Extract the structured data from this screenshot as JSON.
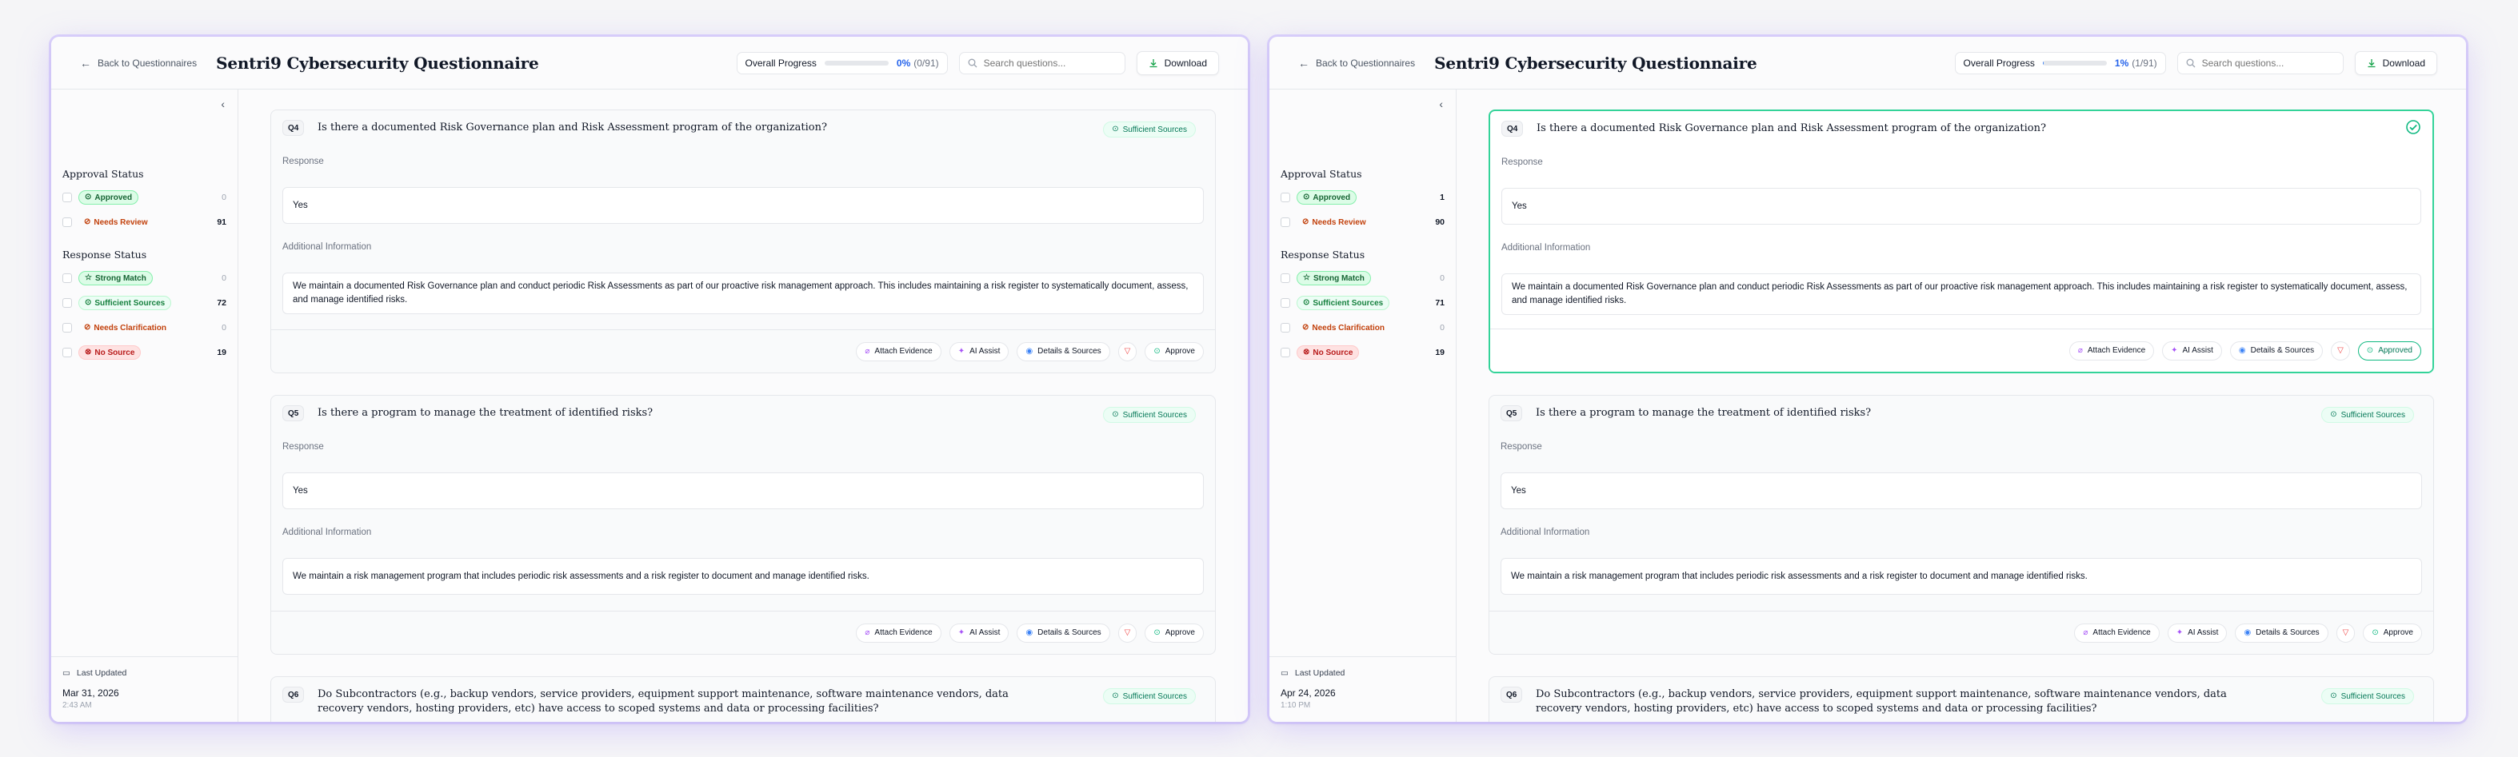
{
  "colors": {
    "accent": "#2563eb",
    "approved": "#10b981",
    "needs_review": "#c2410c",
    "no_source": "#b91c1c"
  },
  "panels": [
    {
      "header": {
        "back_label": "Back to Questionnaires",
        "title": "Sentri9 Cybersecurity Questionnaire",
        "progress_label": "Overall Progress",
        "progress_pct": "0%",
        "progress_count": "(0/91)",
        "progress_fraction": 0.0,
        "search_placeholder": "Search questions...",
        "download_label": "Download"
      },
      "sidebar": {
        "approval_heading": "Approval Status",
        "approved_label": "Approved",
        "approved_count": "0",
        "needs_review_label": "Needs Review",
        "needs_review_count": "91",
        "response_heading": "Response Status",
        "strong_label": "Strong Match",
        "strong_count": "0",
        "sufficient_label": "Sufficient Sources",
        "sufficient_count": "72",
        "clarify_label": "Needs Clarification",
        "clarify_count": "0",
        "nosource_label": "No Source",
        "nosource_count": "19",
        "last_updated_label": "Last Updated",
        "date": "Mar 31, 2026",
        "time": "2:43 AM"
      },
      "questions": [
        {
          "no": "Q4",
          "text": "Is there a documented Risk Governance plan and Risk Assessment program of the organization?",
          "source": "Sufficient Sources",
          "response_label": "Response",
          "response": "Yes",
          "additional_label": "Additional Information",
          "additional": "We maintain a documented Risk Governance plan and conduct periodic Risk Assessments as part of our proactive risk management approach. This includes maintaining a risk register to systematically document, assess, and manage identified risks.",
          "attach": "Attach Evidence",
          "assist": "AI Assist",
          "details": "Details & Sources",
          "approve": "Approve"
        },
        {
          "no": "Q5",
          "text": "Is there a program to manage the treatment of identified risks?",
          "source": "Sufficient Sources",
          "response_label": "Response",
          "response": "Yes",
          "additional_label": "Additional Information",
          "additional": "We maintain a risk management program that includes periodic risk assessments and a risk register to document and manage identified risks.",
          "attach": "Attach Evidence",
          "assist": "AI Assist",
          "details": "Details & Sources",
          "approve": "Approve"
        },
        {
          "no": "Q6",
          "text": "Do Subcontractors (e.g., backup vendors, service providers, equipment support maintenance, software maintenance vendors, data recovery vendors, hosting providers, etc) have access to scoped systems and data or processing facilities?",
          "source": "Sufficient Sources"
        }
      ]
    },
    {
      "header": {
        "back_label": "Back to Questionnaires",
        "title": "Sentri9 Cybersecurity Questionnaire",
        "progress_label": "Overall Progress",
        "progress_pct": "1%",
        "progress_count": "(1/91)",
        "progress_fraction": 0.01,
        "search_placeholder": "Search questions...",
        "download_label": "Download"
      },
      "sidebar": {
        "approval_heading": "Approval Status",
        "approved_label": "Approved",
        "approved_count": "1",
        "needs_review_label": "Needs Review",
        "needs_review_count": "90",
        "response_heading": "Response Status",
        "strong_label": "Strong Match",
        "strong_count": "0",
        "sufficient_label": "Sufficient Sources",
        "sufficient_count": "71",
        "clarify_label": "Needs Clarification",
        "clarify_count": "0",
        "nosource_label": "No Source",
        "nosource_count": "19",
        "last_updated_label": "Last Updated",
        "date": "Apr 24, 2026",
        "time": "1:10 PM"
      },
      "questions": [
        {
          "no": "Q4",
          "text": "Is there a documented Risk Governance plan and Risk Assessment program of the organization?",
          "response_label": "Response",
          "response": "Yes",
          "additional_label": "Additional Information",
          "additional": "We maintain a documented Risk Governance plan and conduct periodic Risk Assessments as part of our proactive risk management approach. This includes maintaining a risk register to systematically document, assess, and manage identified risks.",
          "attach": "Attach Evidence",
          "assist": "AI Assist",
          "details": "Details & Sources",
          "approve": "Approved"
        },
        {
          "no": "Q5",
          "text": "Is there a program to manage the treatment of identified risks?",
          "source": "Sufficient Sources",
          "response_label": "Response",
          "response": "Yes",
          "additional_label": "Additional Information",
          "additional": "We maintain a risk management program that includes periodic risk assessments and a risk register to document and manage identified risks.",
          "attach": "Attach Evidence",
          "assist": "AI Assist",
          "details": "Details & Sources",
          "approve": "Approve"
        },
        {
          "no": "Q6",
          "text": "Do Subcontractors (e.g., backup vendors, service providers, equipment support maintenance, software maintenance vendors, data recovery vendors, hosting providers, etc) have access to scoped systems and data or processing facilities?",
          "source": "Sufficient Sources"
        }
      ]
    }
  ]
}
